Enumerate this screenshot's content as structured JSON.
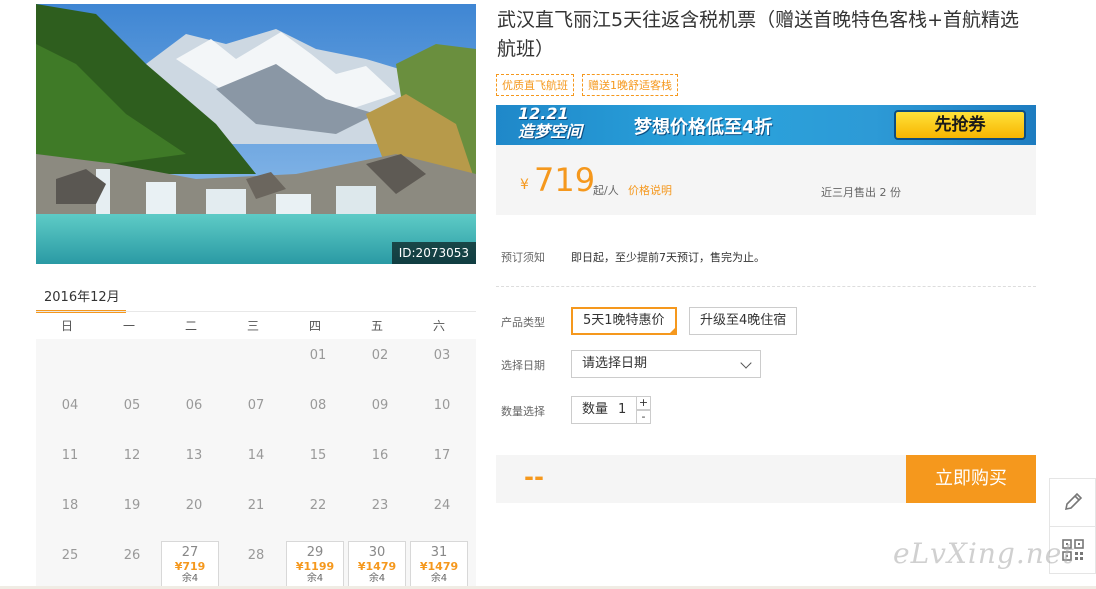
{
  "product": {
    "title": "武汉直飞丽江5天往返含税机票（赠送首晚特色客栈+首航精选航班）",
    "photo_id": "ID:2073053",
    "tags": [
      "优质直飞航班",
      "赠送1晚舒适客栈"
    ]
  },
  "banner": {
    "date": "12.21",
    "slogan": "造梦空间",
    "mid": "梦想价格低至4折",
    "button": "先抢券"
  },
  "price": {
    "currency": "¥",
    "amount": "719",
    "unit": "起/人",
    "desc_link": "价格说明",
    "sold": "近三月售出 2 份"
  },
  "notice": {
    "label": "预订须知",
    "text": "即日起，至少提前7天预订，售完为止。"
  },
  "options": {
    "product_type_label": "产品类型",
    "product_types": [
      "5天1晚特惠价",
      "升级至4晚住宿"
    ],
    "date_label": "选择日期",
    "date_placeholder": "请选择日期",
    "qty_label": "数量选择",
    "qty_prefix": "数量",
    "qty_value": "1",
    "plus": "+",
    "minus": "-"
  },
  "buy": {
    "total": "--",
    "button": "立即购买"
  },
  "calendar": {
    "month": "2016年12月",
    "weekdays": [
      "日",
      "一",
      "二",
      "三",
      "四",
      "五",
      "六"
    ],
    "days": [
      {
        "d": "01",
        "col": 4,
        "row": 0
      },
      {
        "d": "02",
        "col": 5,
        "row": 0
      },
      {
        "d": "03",
        "col": 6,
        "row": 0
      },
      {
        "d": "04",
        "col": 0,
        "row": 1
      },
      {
        "d": "05",
        "col": 1,
        "row": 1
      },
      {
        "d": "06",
        "col": 2,
        "row": 1
      },
      {
        "d": "07",
        "col": 3,
        "row": 1
      },
      {
        "d": "08",
        "col": 4,
        "row": 1
      },
      {
        "d": "09",
        "col": 5,
        "row": 1
      },
      {
        "d": "10",
        "col": 6,
        "row": 1
      },
      {
        "d": "11",
        "col": 0,
        "row": 2
      },
      {
        "d": "12",
        "col": 1,
        "row": 2
      },
      {
        "d": "13",
        "col": 2,
        "row": 2
      },
      {
        "d": "14",
        "col": 3,
        "row": 2
      },
      {
        "d": "15",
        "col": 4,
        "row": 2
      },
      {
        "d": "16",
        "col": 5,
        "row": 2
      },
      {
        "d": "17",
        "col": 6,
        "row": 2
      },
      {
        "d": "18",
        "col": 0,
        "row": 3
      },
      {
        "d": "19",
        "col": 1,
        "row": 3
      },
      {
        "d": "20",
        "col": 2,
        "row": 3
      },
      {
        "d": "21",
        "col": 3,
        "row": 3
      },
      {
        "d": "22",
        "col": 4,
        "row": 3
      },
      {
        "d": "23",
        "col": 5,
        "row": 3
      },
      {
        "d": "24",
        "col": 6,
        "row": 3
      },
      {
        "d": "25",
        "col": 0,
        "row": 4
      },
      {
        "d": "26",
        "col": 1,
        "row": 4
      },
      {
        "d": "27",
        "col": 2,
        "row": 4,
        "price": "¥719",
        "remain": "余4"
      },
      {
        "d": "28",
        "col": 3,
        "row": 4
      },
      {
        "d": "29",
        "col": 4,
        "row": 4,
        "price": "¥1199",
        "remain": "余4"
      },
      {
        "d": "30",
        "col": 5,
        "row": 4,
        "price": "¥1479",
        "remain": "余4"
      },
      {
        "d": "31",
        "col": 6,
        "row": 4,
        "price": "¥1479",
        "remain": "余4"
      }
    ]
  },
  "watermark": "eLvXing.net",
  "icons": [
    "pencil-icon",
    "qrcode-icon",
    "chevron-down-icon"
  ],
  "colors": {
    "accent": "#f5981d",
    "banner_blue": "#2aa3dc",
    "panel_bg": "#f5f5f5"
  }
}
